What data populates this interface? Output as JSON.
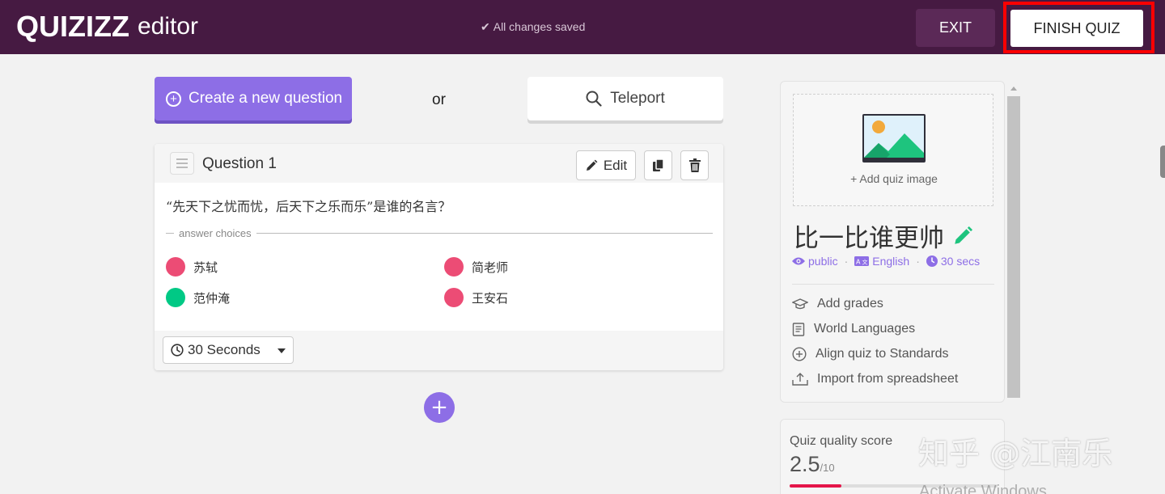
{
  "header": {
    "logo": "QUIZIZZ",
    "mode": "editor",
    "status": "All changes saved",
    "exit_label": "EXIT",
    "finish_label": "FINISH QUIZ"
  },
  "toolbar": {
    "create_label": "Create a new question",
    "or_label": "or",
    "teleport_label": "Teleport"
  },
  "question": {
    "title": "Question 1",
    "edit_label": "Edit",
    "text": "“先天下之忧而忧，后天下之乐而乐”是谁的名言？",
    "answer_choices_label": "answer choices",
    "choices": [
      {
        "text": "苏轼",
        "correct": false
      },
      {
        "text": "简老师",
        "correct": false
      },
      {
        "text": "范仲淹",
        "correct": true
      },
      {
        "text": "王安石",
        "correct": false
      }
    ],
    "time_value": "30 Seconds"
  },
  "quiz_panel": {
    "add_image_label": "+ Add quiz image",
    "title": "比一比谁更帅",
    "visibility": "public",
    "language": "English",
    "time": "30 secs",
    "menu": [
      {
        "label": "Add grades",
        "icon": "graduation-cap-icon"
      },
      {
        "label": "World Languages",
        "icon": "book-icon"
      },
      {
        "label": "Align quiz to Standards",
        "icon": "plus-circle-icon"
      },
      {
        "label": "Import from spreadsheet",
        "icon": "upload-icon"
      }
    ]
  },
  "quality": {
    "label": "Quiz quality score",
    "score": "2.5",
    "out_of": "/10",
    "fraction": 0.25
  },
  "overlay": {
    "watermark": "知乎 @江南乐",
    "activate": "Activate Windows"
  },
  "colors": {
    "header_bg": "#461a42",
    "accent_purple": "#8d6ee6",
    "correct": "#00c985",
    "incorrect": "#ec4c75",
    "highlight_red": "#ff0000"
  }
}
